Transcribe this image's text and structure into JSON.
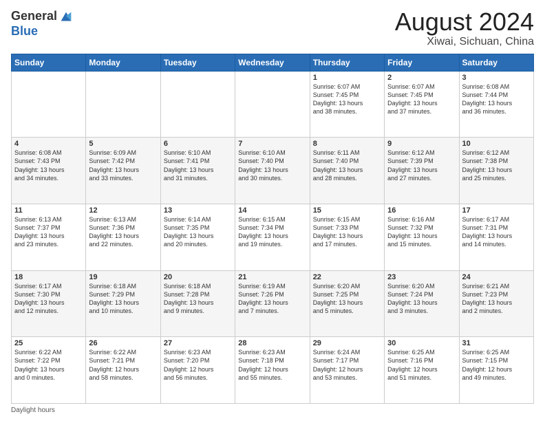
{
  "header": {
    "logo_general": "General",
    "logo_blue": "Blue",
    "month_title": "August 2024",
    "location": "Xiwai, Sichuan, China"
  },
  "days_of_week": [
    "Sunday",
    "Monday",
    "Tuesday",
    "Wednesday",
    "Thursday",
    "Friday",
    "Saturday"
  ],
  "weeks": [
    [
      {
        "day": "",
        "info": ""
      },
      {
        "day": "",
        "info": ""
      },
      {
        "day": "",
        "info": ""
      },
      {
        "day": "",
        "info": ""
      },
      {
        "day": "1",
        "info": "Sunrise: 6:07 AM\nSunset: 7:45 PM\nDaylight: 13 hours\nand 38 minutes."
      },
      {
        "day": "2",
        "info": "Sunrise: 6:07 AM\nSunset: 7:45 PM\nDaylight: 13 hours\nand 37 minutes."
      },
      {
        "day": "3",
        "info": "Sunrise: 6:08 AM\nSunset: 7:44 PM\nDaylight: 13 hours\nand 36 minutes."
      }
    ],
    [
      {
        "day": "4",
        "info": "Sunrise: 6:08 AM\nSunset: 7:43 PM\nDaylight: 13 hours\nand 34 minutes."
      },
      {
        "day": "5",
        "info": "Sunrise: 6:09 AM\nSunset: 7:42 PM\nDaylight: 13 hours\nand 33 minutes."
      },
      {
        "day": "6",
        "info": "Sunrise: 6:10 AM\nSunset: 7:41 PM\nDaylight: 13 hours\nand 31 minutes."
      },
      {
        "day": "7",
        "info": "Sunrise: 6:10 AM\nSunset: 7:40 PM\nDaylight: 13 hours\nand 30 minutes."
      },
      {
        "day": "8",
        "info": "Sunrise: 6:11 AM\nSunset: 7:40 PM\nDaylight: 13 hours\nand 28 minutes."
      },
      {
        "day": "9",
        "info": "Sunrise: 6:12 AM\nSunset: 7:39 PM\nDaylight: 13 hours\nand 27 minutes."
      },
      {
        "day": "10",
        "info": "Sunrise: 6:12 AM\nSunset: 7:38 PM\nDaylight: 13 hours\nand 25 minutes."
      }
    ],
    [
      {
        "day": "11",
        "info": "Sunrise: 6:13 AM\nSunset: 7:37 PM\nDaylight: 13 hours\nand 23 minutes."
      },
      {
        "day": "12",
        "info": "Sunrise: 6:13 AM\nSunset: 7:36 PM\nDaylight: 13 hours\nand 22 minutes."
      },
      {
        "day": "13",
        "info": "Sunrise: 6:14 AM\nSunset: 7:35 PM\nDaylight: 13 hours\nand 20 minutes."
      },
      {
        "day": "14",
        "info": "Sunrise: 6:15 AM\nSunset: 7:34 PM\nDaylight: 13 hours\nand 19 minutes."
      },
      {
        "day": "15",
        "info": "Sunrise: 6:15 AM\nSunset: 7:33 PM\nDaylight: 13 hours\nand 17 minutes."
      },
      {
        "day": "16",
        "info": "Sunrise: 6:16 AM\nSunset: 7:32 PM\nDaylight: 13 hours\nand 15 minutes."
      },
      {
        "day": "17",
        "info": "Sunrise: 6:17 AM\nSunset: 7:31 PM\nDaylight: 13 hours\nand 14 minutes."
      }
    ],
    [
      {
        "day": "18",
        "info": "Sunrise: 6:17 AM\nSunset: 7:30 PM\nDaylight: 13 hours\nand 12 minutes."
      },
      {
        "day": "19",
        "info": "Sunrise: 6:18 AM\nSunset: 7:29 PM\nDaylight: 13 hours\nand 10 minutes."
      },
      {
        "day": "20",
        "info": "Sunrise: 6:18 AM\nSunset: 7:28 PM\nDaylight: 13 hours\nand 9 minutes."
      },
      {
        "day": "21",
        "info": "Sunrise: 6:19 AM\nSunset: 7:26 PM\nDaylight: 13 hours\nand 7 minutes."
      },
      {
        "day": "22",
        "info": "Sunrise: 6:20 AM\nSunset: 7:25 PM\nDaylight: 13 hours\nand 5 minutes."
      },
      {
        "day": "23",
        "info": "Sunrise: 6:20 AM\nSunset: 7:24 PM\nDaylight: 13 hours\nand 3 minutes."
      },
      {
        "day": "24",
        "info": "Sunrise: 6:21 AM\nSunset: 7:23 PM\nDaylight: 13 hours\nand 2 minutes."
      }
    ],
    [
      {
        "day": "25",
        "info": "Sunrise: 6:22 AM\nSunset: 7:22 PM\nDaylight: 13 hours\nand 0 minutes."
      },
      {
        "day": "26",
        "info": "Sunrise: 6:22 AM\nSunset: 7:21 PM\nDaylight: 12 hours\nand 58 minutes."
      },
      {
        "day": "27",
        "info": "Sunrise: 6:23 AM\nSunset: 7:20 PM\nDaylight: 12 hours\nand 56 minutes."
      },
      {
        "day": "28",
        "info": "Sunrise: 6:23 AM\nSunset: 7:18 PM\nDaylight: 12 hours\nand 55 minutes."
      },
      {
        "day": "29",
        "info": "Sunrise: 6:24 AM\nSunset: 7:17 PM\nDaylight: 12 hours\nand 53 minutes."
      },
      {
        "day": "30",
        "info": "Sunrise: 6:25 AM\nSunset: 7:16 PM\nDaylight: 12 hours\nand 51 minutes."
      },
      {
        "day": "31",
        "info": "Sunrise: 6:25 AM\nSunset: 7:15 PM\nDaylight: 12 hours\nand 49 minutes."
      }
    ]
  ],
  "footer": {
    "note": "Daylight hours"
  }
}
